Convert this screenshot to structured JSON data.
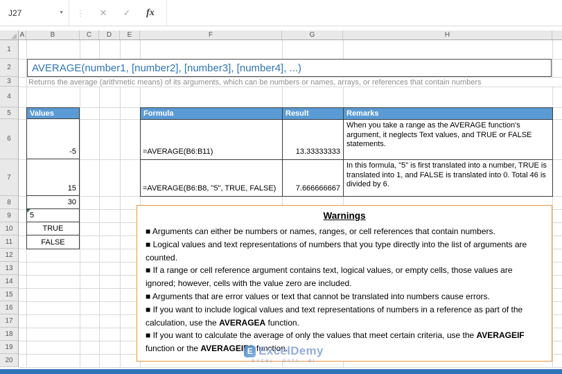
{
  "toolbar": {
    "name_box": "J27",
    "caret_glyph": "▼",
    "dots_glyph": "⋮",
    "cancel_glyph": "✕",
    "enter_glyph": "✓",
    "fx_label": "fx"
  },
  "grid": {
    "column_headers": [
      "A",
      "B",
      "C",
      "D",
      "E",
      "F",
      "G",
      "H"
    ],
    "row_numbers": [
      "1",
      "2",
      "3",
      "4",
      "5",
      "6",
      "7",
      "8",
      "9",
      "10",
      "11",
      "12",
      "13",
      "14",
      "15",
      "16",
      "17",
      "18",
      "19",
      "20"
    ]
  },
  "title_box": {
    "text": "AVERAGE(number1, [number2], [number3], [number4], ...)"
  },
  "subtitle": {
    "text": "Returns the average (arithmetic means) of its arguments, which can be numbers or names, arrays, or references that contain numbers"
  },
  "values_table": {
    "header": "Values",
    "cells": [
      {
        "value": "-5"
      },
      {
        "value": "15"
      },
      {
        "value": "30"
      },
      {
        "value": "5",
        "error_marker": true
      },
      {
        "value": "TRUE"
      },
      {
        "value": "FALSE"
      }
    ]
  },
  "formula_table": {
    "headers": [
      "Formula",
      "Result",
      "Remarks"
    ],
    "rows": [
      {
        "formula": "=AVERAGE(B6:B11)",
        "result": "13.33333333",
        "remarks": "When you take a range as the AVERAGE function's argument, it neglects Text values, and TRUE or FALSE statements."
      },
      {
        "formula": "=AVERAGE(B6:B8, \"5\", TRUE, FALSE)",
        "result": "7.666666667",
        "remarks": "In this formula, \"5\" is first translated into a number, TRUE is translated into 1, and FALSE is translated into 0. Total 46 is divided by 6."
      }
    ]
  },
  "warnings": {
    "title": "Warnings",
    "bullets": [
      [
        {
          "text": "■ Arguments can either be numbers or names, ranges, or cell references that contain numbers."
        }
      ],
      [
        {
          "text": "■ Logical values and text representations of numbers that you type directly into the list of arguments are counted."
        }
      ],
      [
        {
          "text": "■ If a range or cell reference argument contains text, logical values, or empty cells, those values are ignored; however, cells with the value zero are included."
        }
      ],
      [
        {
          "text": "■ Arguments that are error values or text that cannot be translated into numbers cause errors."
        }
      ],
      [
        {
          "text": "■ If you want to include logical values and text representations of numbers in a reference as part of the calculation, use the "
        },
        {
          "text": "AVERAGEA",
          "bold": true
        },
        {
          "text": " function."
        }
      ],
      [
        {
          "text": "■ If you want to calculate the average of only the values that meet certain criteria, use the "
        },
        {
          "text": "AVERAGEIF",
          "bold": true
        },
        {
          "text": " function or the "
        },
        {
          "text": "AVERAGEIFS",
          "bold": true
        },
        {
          "text": " function."
        }
      ]
    ]
  },
  "watermark": {
    "icon_letter": "E",
    "name": "ExcelDemy",
    "tagline": "EXCEL - DATA - BI"
  },
  "colors": {
    "header_blue": "#5B9BD5",
    "title_blue": "#2E75B6",
    "warning_border": "#E8973F",
    "bottom_bar": "#2E75B6",
    "watermark_blue": "#8FA9DD",
    "error_green": "#1E7145"
  }
}
